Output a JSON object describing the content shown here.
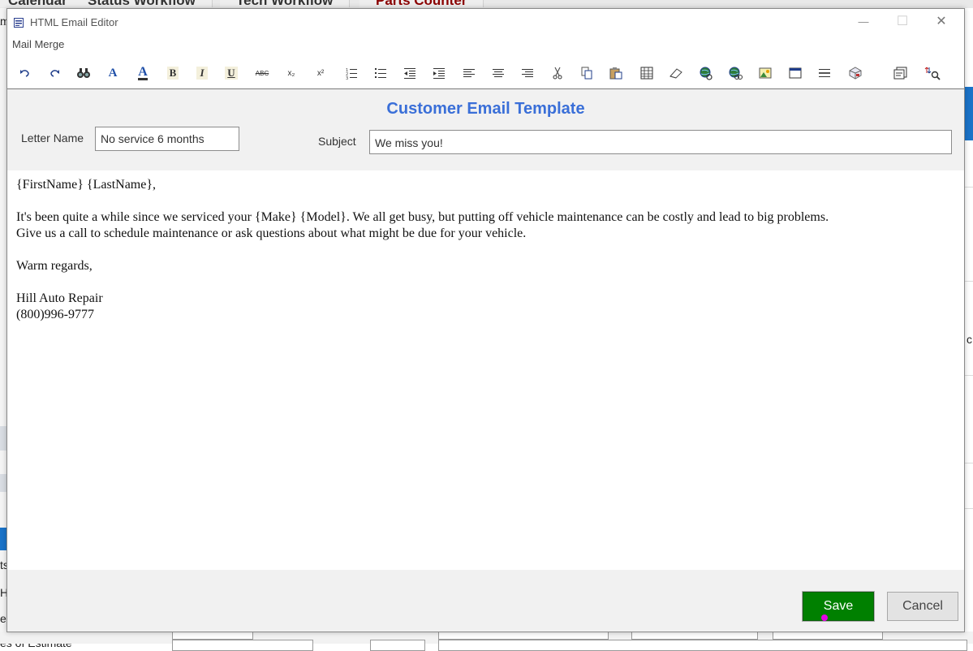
{
  "background": {
    "tabs": [
      "Calendar",
      "Status Workflow",
      "Tech Workflow",
      "Parts Counter"
    ],
    "fragments": [
      "m",
      "ts",
      "H",
      "e",
      "es of Estimate",
      "c"
    ]
  },
  "window": {
    "title": "HTML Email Editor",
    "minimize": "—",
    "maximize": "☐",
    "close": "✕"
  },
  "menu": {
    "mail_merge": "Mail Merge"
  },
  "toolbar": {
    "icons": [
      "undo-icon",
      "redo-icon",
      "find-icon",
      "font-color-icon",
      "highlight-icon",
      "bold-icon",
      "italic-icon",
      "underline-icon",
      "strikethrough-icon",
      "subscript-icon",
      "superscript-icon",
      "numbered-list-icon",
      "bullet-list-icon",
      "outdent-icon",
      "indent-icon",
      "align-left-icon",
      "align-center-icon",
      "align-right-icon",
      "cut-icon",
      "copy-icon",
      "paste-icon",
      "table-icon",
      "eraser-icon",
      "hyperlink-icon",
      "unlink-icon",
      "image-icon",
      "window-icon",
      "horizontal-rule-icon",
      "special-object-icon",
      "html-source-icon",
      "find-replace-icon"
    ],
    "glyphs": {
      "bold": "B",
      "italic": "I",
      "underline": "U",
      "strike": "ABC",
      "subscript": "x₂",
      "superscript": "x²",
      "font_a": "A"
    }
  },
  "form": {
    "title": "Customer Email Template",
    "letter_name_label": "Letter Name",
    "letter_name_value": "No service 6 months",
    "subject_label": "Subject",
    "subject_value": "We miss you!"
  },
  "editor": {
    "greeting": "{FirstName} {LastName},",
    "body_line1": "It's been quite a while since we serviced your {Make} {Model}. We all get busy, but putting off vehicle maintenance can be costly and lead to big problems.",
    "body_line2": "Give us a call to schedule maintenance or ask questions about what might be due for your vehicle.",
    "closing": "Warm regards,",
    "signature_name": "Hill Auto Repair",
    "signature_phone": "(800)996-9777"
  },
  "buttons": {
    "save": "Save",
    "cancel": "Cancel"
  },
  "colors": {
    "title_blue": "#3a6fd8",
    "save_green": "#008000",
    "app_blue": "#1a73c8",
    "parts_red": "#8b0000"
  }
}
